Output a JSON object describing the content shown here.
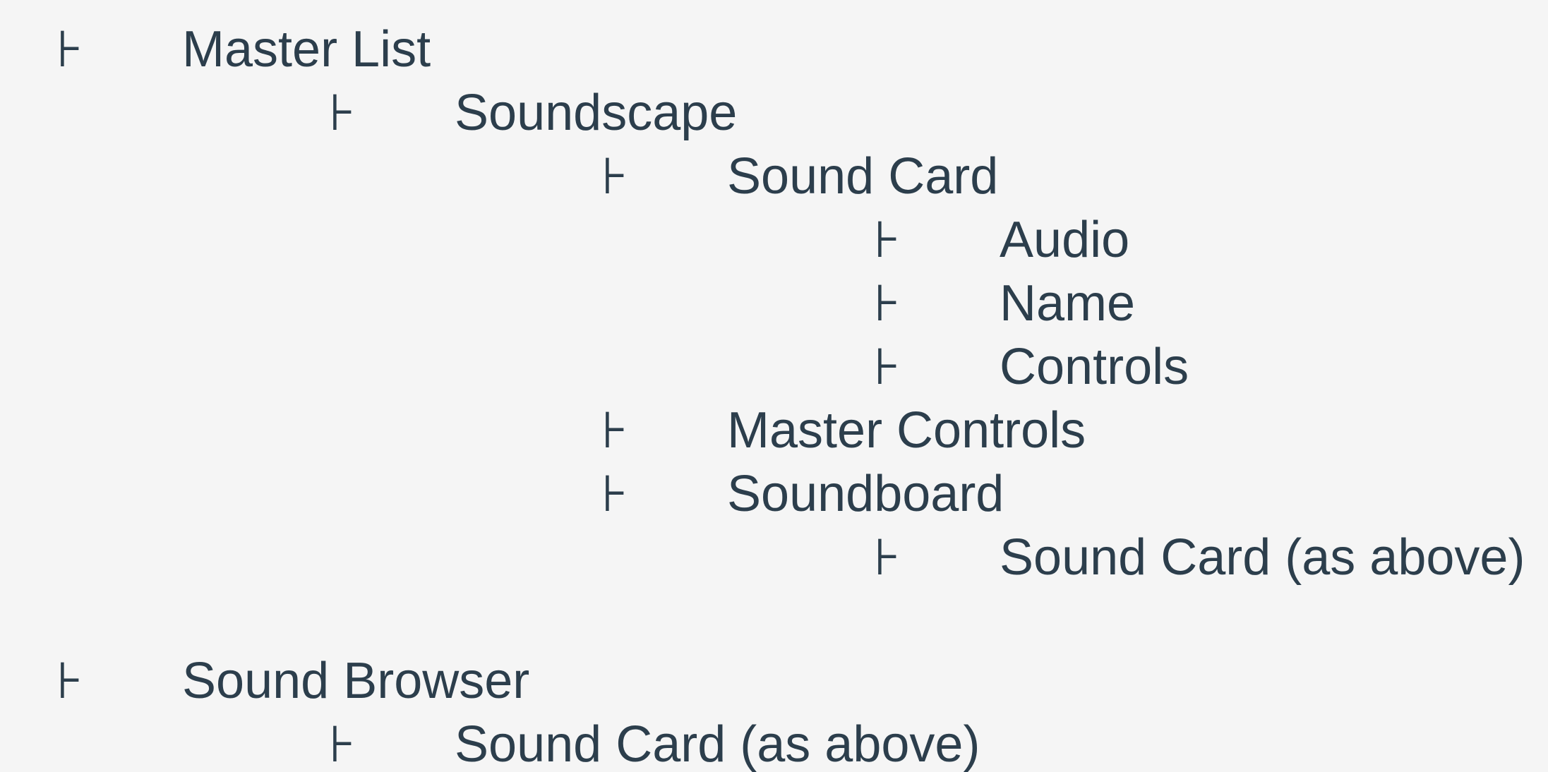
{
  "tree": {
    "bullet_glyph": "⊦",
    "text_color": "#2c3e4c",
    "background_color": "#f5f5f5",
    "items": [
      {
        "label": "Master List",
        "level": 0
      },
      {
        "label": "Soundscape",
        "level": 1
      },
      {
        "label": "Sound Card",
        "level": 2
      },
      {
        "label": "Audio",
        "level": 3
      },
      {
        "label": "Name",
        "level": 3
      },
      {
        "label": "Controls",
        "level": 3
      },
      {
        "label": "Master Controls",
        "level": 2
      },
      {
        "label": "Soundboard",
        "level": 2
      },
      {
        "label": "Sound Card (as above)",
        "level": 3
      },
      {
        "label": "Sound Browser",
        "level": 0
      },
      {
        "label": "Sound Card (as above)",
        "level": 1
      }
    ]
  }
}
